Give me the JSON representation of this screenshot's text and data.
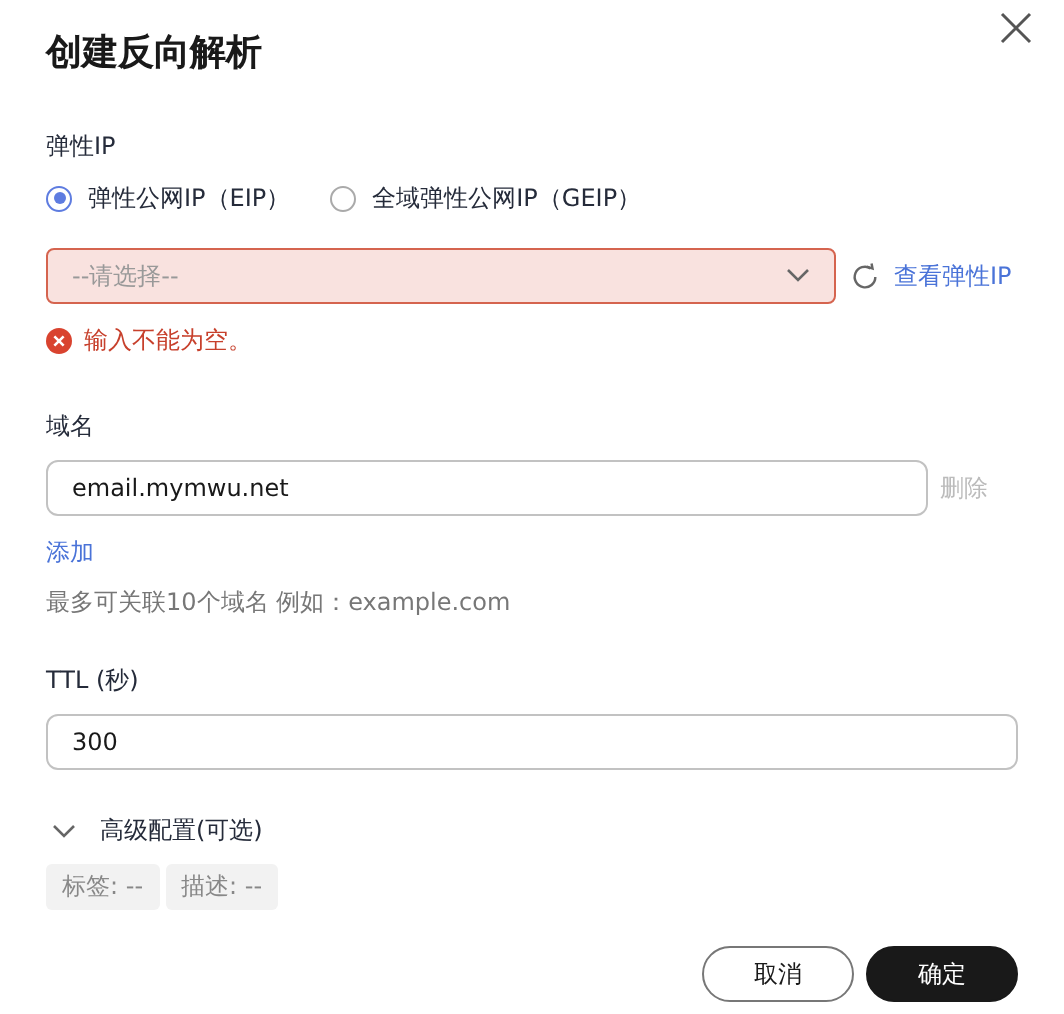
{
  "dialog": {
    "title": "创建反向解析"
  },
  "eip": {
    "label": "弹性IP",
    "options": [
      {
        "label": "弹性公网IP（EIP）",
        "selected": true
      },
      {
        "label": "全域弹性公网IP（GEIP）",
        "selected": false
      }
    ],
    "select": {
      "placeholder": "--请选择--",
      "error": true
    },
    "link": "查看弹性IP",
    "error_message": "输入不能为空。"
  },
  "domain": {
    "label": "域名",
    "entries": [
      {
        "value": "email.mymwu.net",
        "delete_label": "删除",
        "delete_disabled": true
      }
    ],
    "add_link": "添加",
    "hint": "最多可关联10个域名 例如：example.com"
  },
  "ttl": {
    "label": "TTL (秒)",
    "value": "300"
  },
  "advanced": {
    "label": "高级配置(可选)",
    "expanded": false,
    "tags": [
      "标签: --",
      "描述: --"
    ]
  },
  "buttons": [
    {
      "label": "取消",
      "kind": "secondary"
    },
    {
      "label": "确定",
      "kind": "primary"
    }
  ]
}
